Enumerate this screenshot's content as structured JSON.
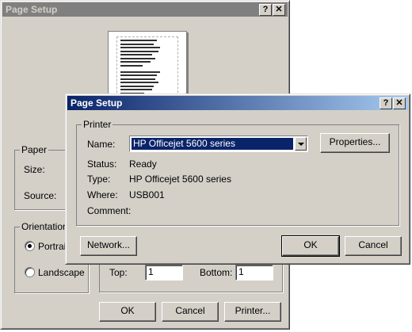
{
  "back_dialog": {
    "title": "Page Setup",
    "help_glyph": "?",
    "close_glyph": "✕",
    "paper_group": "Paper",
    "size_label": "Size:",
    "source_label": "Source:",
    "orientation_group": "Orientation",
    "portrait_label": "Portrait",
    "landscape_label": "Landscape",
    "selected_orientation": "Portrait",
    "top_label": "Top:",
    "top_value": "1",
    "bottom_label": "Bottom:",
    "bottom_value": "1",
    "ok": "OK",
    "cancel": "Cancel",
    "printer": "Printer..."
  },
  "front_dialog": {
    "title": "Page Setup",
    "help_glyph": "?",
    "close_glyph": "✕",
    "printer_group": "Printer",
    "name_label": "Name:",
    "name_value": "HP Officejet 5600 series",
    "properties": "Properties...",
    "status_label": "Status:",
    "status_value": "Ready",
    "type_label": "Type:",
    "type_value": "HP Officejet 5600 series",
    "where_label": "Where:",
    "where_value": "USB001",
    "comment_label": "Comment:",
    "comment_value": "",
    "network": "Network...",
    "ok": "OK",
    "cancel": "Cancel"
  },
  "colors": {
    "face": "#d4d0c8",
    "title_active_start": "#0a246a",
    "title_active_end": "#a6caf0",
    "title_inactive": "#808080",
    "selection": "#0a246a"
  },
  "icons": [
    "help-icon",
    "close-icon",
    "dropdown-arrow-icon"
  ]
}
